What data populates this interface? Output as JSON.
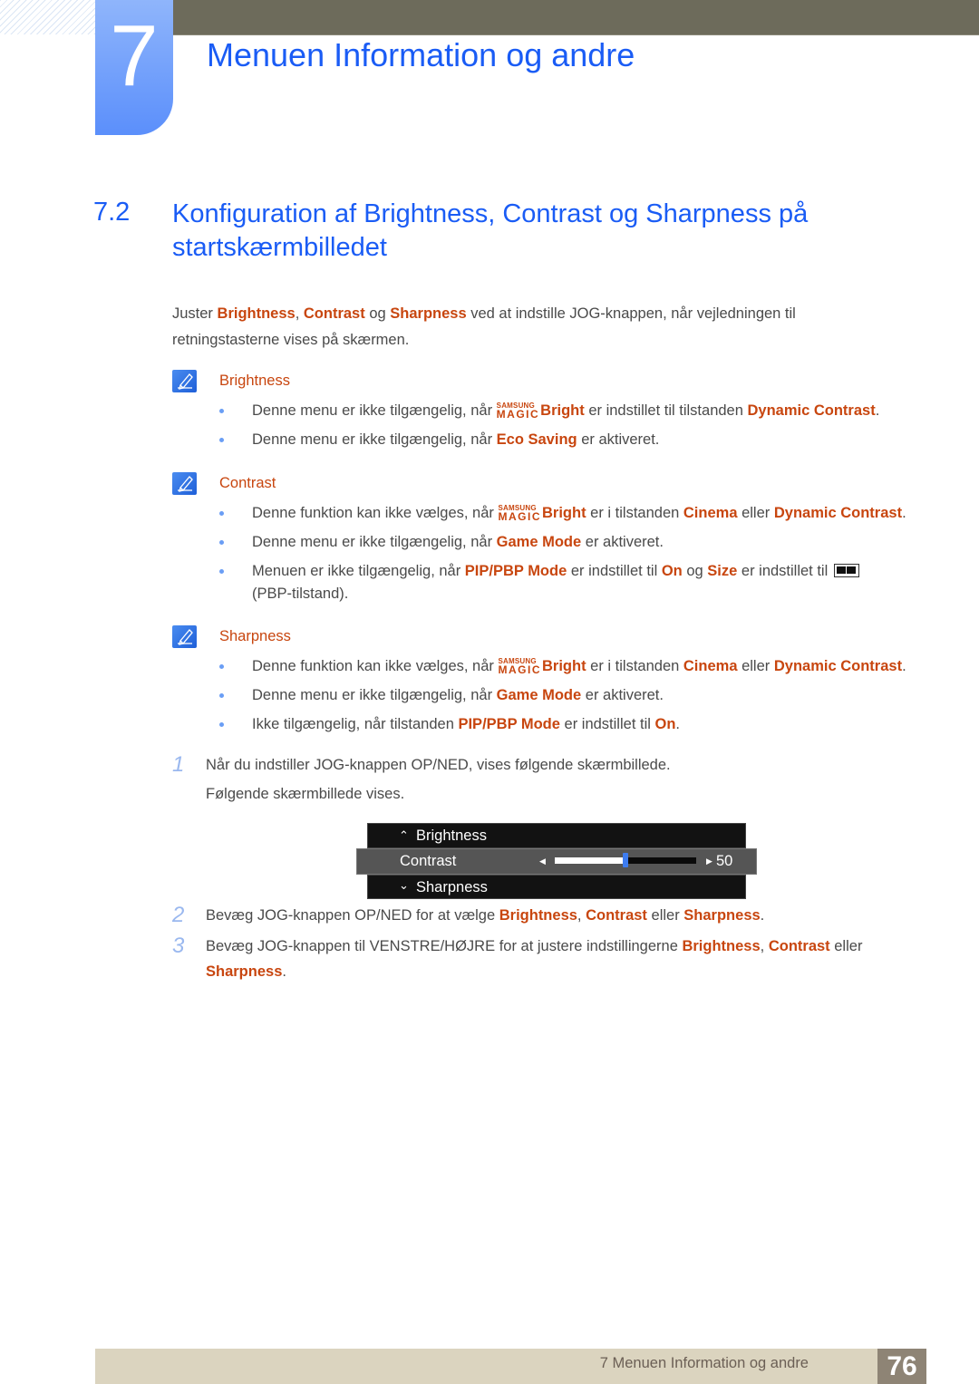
{
  "header": {
    "chapter_number": "7",
    "chapter_title": "Menuen Information og andre"
  },
  "section": {
    "number": "7.2",
    "title": "Konfiguration af Brightness, Contrast og Sharpness på startskærmbilledet"
  },
  "intro": {
    "t1": "Juster ",
    "h1": "Brightness",
    "t2": ", ",
    "h2": "Contrast",
    "t3": " og ",
    "h3": "Sharpness",
    "t4": " ved at indstille JOG-knappen, når vejledningen til retningstasterne vises på skærmen."
  },
  "magic_logo": {
    "top": "SAMSUNG",
    "bottom": "MAGIC"
  },
  "notes": {
    "brightness": {
      "title": "Brightness",
      "b1": {
        "t1": "Denne menu er ikke tilgængelig, når ",
        "h1": "Bright",
        "t2": " er indstillet til tilstanden ",
        "h2": "Dynamic Contrast",
        "t3": "."
      },
      "b2": {
        "t1": "Denne menu er ikke tilgængelig, når ",
        "h1": "Eco Saving",
        "t2": " er aktiveret."
      }
    },
    "contrast": {
      "title": "Contrast",
      "b1": {
        "t1": "Denne funktion kan ikke vælges, når ",
        "h1": "Bright",
        "t2": " er i tilstanden ",
        "h2": "Cinema",
        "t3": " eller ",
        "h3": "Dynamic Contrast",
        "t4": "."
      },
      "b2": {
        "t1": "Denne menu er ikke tilgængelig, når ",
        "h1": "Game Mode",
        "t2": " er aktiveret."
      },
      "b3": {
        "t1": "Menuen er ikke tilgængelig, når ",
        "h1": "PIP/PBP Mode",
        "t2": " er indstillet til ",
        "h2": "On",
        "t3": " og ",
        "h3": "Size",
        "t4": " er indstillet til ",
        "t5": "(PBP-tilstand)."
      }
    },
    "sharpness": {
      "title": "Sharpness",
      "b1": {
        "t1": "Denne funktion kan ikke vælges, når ",
        "h1": "Bright",
        "t2": " er i tilstanden ",
        "h2": "Cinema",
        "t3": " eller ",
        "h3": "Dynamic Contrast",
        "t4": "."
      },
      "b2": {
        "t1": "Denne menu er ikke tilgængelig, når ",
        "h1": "Game Mode",
        "t2": " er aktiveret."
      },
      "b3": {
        "t1": "Ikke tilgængelig, når tilstanden ",
        "h1": "PIP/PBP Mode",
        "t2": " er indstillet til ",
        "h2": "On",
        "t3": "."
      }
    }
  },
  "steps": [
    {
      "num": "1",
      "t1": "Når du indstiller JOG-knappen OP/NED, vises følgende skærmbillede.",
      "t2": "Følgende skærmbillede vises."
    },
    {
      "num": "2",
      "t1": "Bevæg JOG-knappen OP/NED for at vælge ",
      "h1": "Brightness",
      "t2": ", ",
      "h2": "Contrast",
      "t3": " eller ",
      "h3": "Sharpness",
      "t4": "."
    },
    {
      "num": "3",
      "t1": "Bevæg JOG-knappen til VENSTRE/HØJRE for at justere indstillingerne ",
      "h1": "Brightness",
      "t2": ", ",
      "h2": "Contrast",
      "t3": " eller ",
      "h3": "Sharpness",
      "t4": "."
    }
  ],
  "osd": {
    "up_item": "Brightness",
    "current_item": "Contrast",
    "down_item": "Sharpness",
    "value": "50",
    "value_fraction": 0.5
  },
  "footer": {
    "text": "7 Menuen Information og andre",
    "page": "76"
  },
  "colors": {
    "heading_blue": "#1a5cf5",
    "highlight_orange": "#c8460f",
    "header_bar": "#6d6b5b",
    "footer_bar": "#dbd4bf"
  }
}
